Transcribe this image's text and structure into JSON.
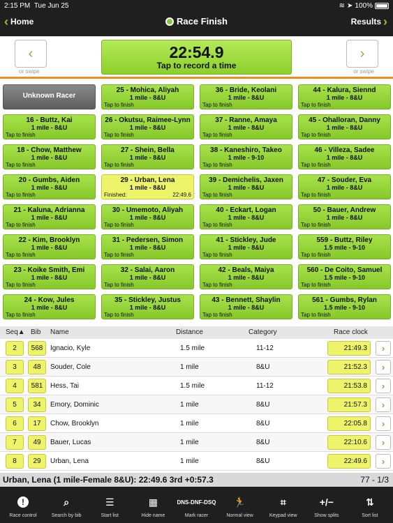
{
  "status_bar": {
    "time": "2:15 PM",
    "date": "Tue Jun 25",
    "battery": "100%"
  },
  "nav": {
    "back_label": "Home",
    "title": "Race Finish",
    "forward_label": "Results"
  },
  "clock": {
    "time": "22:54.9",
    "tap_label": "Tap to record a time",
    "swipe_hint": "or swipe"
  },
  "racers": [
    {
      "name": "Unknown Racer",
      "category": "",
      "note": "",
      "time": "",
      "state": "unknown"
    },
    {
      "name": "25 - Mohica, Aliyah",
      "category": "1 mile - 8&U",
      "note": "Tap to finish",
      "time": "",
      "state": "open"
    },
    {
      "name": "36 - Bride, Keolani",
      "category": "1 mile - 8&U",
      "note": "Tap to finish",
      "time": "",
      "state": "open"
    },
    {
      "name": "44 - Kalura, Siennd",
      "category": "1 mile - 8&U",
      "note": "Tap to finish",
      "time": "",
      "state": "open"
    },
    {
      "name": "16 - Buttz, Kai",
      "category": "1 mile - 8&U",
      "note": "Tap to finish",
      "time": "",
      "state": "open"
    },
    {
      "name": "26 - Okutsu, Raimee-Lynn",
      "category": "1 mile - 8&U",
      "note": "Tap to finish",
      "time": "",
      "state": "open"
    },
    {
      "name": "37 - Ranne, Amaya",
      "category": "1 mile - 8&U",
      "note": "Tap to finish",
      "time": "",
      "state": "open"
    },
    {
      "name": "45 - Ohalloran, Danny",
      "category": "1 mile - 8&U",
      "note": "Tap to finish",
      "time": "",
      "state": "open"
    },
    {
      "name": "18 - Chow, Matthew",
      "category": "1 mile - 8&U",
      "note": "Tap to finish",
      "time": "",
      "state": "open"
    },
    {
      "name": "27 - Shein, Bella",
      "category": "1 mile - 8&U",
      "note": "Tap to finish",
      "time": "",
      "state": "open"
    },
    {
      "name": "38 - Kaneshiro, Takeo",
      "category": "1 mile - 9-10",
      "note": "Tap to finish",
      "time": "",
      "state": "open"
    },
    {
      "name": "46 - Villeza, Sadee",
      "category": "1 mile - 8&U",
      "note": "Tap to finish",
      "time": "",
      "state": "open"
    },
    {
      "name": "20 - Gumbs, Aiden",
      "category": "1 mile - 8&U",
      "note": "Tap to finish",
      "time": "",
      "state": "open"
    },
    {
      "name": "29 - Urban, Lena",
      "category": "1 mile - 8&U",
      "note": "Finished:",
      "time": "22:49.6",
      "state": "finished"
    },
    {
      "name": "39 - Demichelis, Jaxen",
      "category": "1 mile - 8&U",
      "note": "Tap to finish",
      "time": "",
      "state": "open"
    },
    {
      "name": "47 - Souder, Eva",
      "category": "1 mile - 8&U",
      "note": "Tap to finish",
      "time": "",
      "state": "open"
    },
    {
      "name": "21 - Kaluna, Adrianna",
      "category": "1 mile - 8&U",
      "note": "Tap to finish",
      "time": "",
      "state": "open"
    },
    {
      "name": "30 - Umemoto, Aliyah",
      "category": "1 mile - 8&U",
      "note": "Tap to finish",
      "time": "",
      "state": "open"
    },
    {
      "name": "40 - Eckart, Logan",
      "category": "1 mile - 8&U",
      "note": "Tap to finish",
      "time": "",
      "state": "open"
    },
    {
      "name": "50 - Bauer, Andrew",
      "category": "1 mile - 8&U",
      "note": "Tap to finish",
      "time": "",
      "state": "open"
    },
    {
      "name": "22 - Kim, Brooklyn",
      "category": "1 mile - 8&U",
      "note": "Tap to finish",
      "time": "",
      "state": "open"
    },
    {
      "name": "31 - Pedersen, Simon",
      "category": "1 mile - 8&U",
      "note": "Tap to finish",
      "time": "",
      "state": "open"
    },
    {
      "name": "41 - Stickley, Jude",
      "category": "1 mile - 8&U",
      "note": "Tap to finish",
      "time": "",
      "state": "open"
    },
    {
      "name": "559 - Buttz, Riley",
      "category": "1.5 mile - 9-10",
      "note": "Tap to finish",
      "time": "",
      "state": "open"
    },
    {
      "name": "23 - Koike Smith, Emi",
      "category": "1 mile - 8&U",
      "note": "Tap to finish",
      "time": "",
      "state": "open"
    },
    {
      "name": "32 - Salai, Aaron",
      "category": "1 mile - 8&U",
      "note": "Tap to finish",
      "time": "",
      "state": "open"
    },
    {
      "name": "42 - Beals, Maiya",
      "category": "1 mile - 8&U",
      "note": "Tap to finish",
      "time": "",
      "state": "open"
    },
    {
      "name": "560 - De Coito, Samuel",
      "category": "1.5 mile - 9-10",
      "note": "Tap to finish",
      "time": "",
      "state": "open"
    },
    {
      "name": "24 - Kow, Jules",
      "category": "1 mile - 8&U",
      "note": "Tap to finish",
      "time": "",
      "state": "open"
    },
    {
      "name": "35 - Stickley, Justus",
      "category": "1 mile - 8&U",
      "note": "Tap to finish",
      "time": "",
      "state": "open"
    },
    {
      "name": "43 - Bennett, Shaylin",
      "category": "1 mile - 8&U",
      "note": "Tap to finish",
      "time": "",
      "state": "open"
    },
    {
      "name": "561 - Gumbs, Rylan",
      "category": "1.5 mile - 9-10",
      "note": "Tap to finish",
      "time": "",
      "state": "open"
    }
  ],
  "table": {
    "headers": {
      "seq": "Seq▲",
      "bib": "Bib",
      "name": "Name",
      "distance": "Distance",
      "category": "Category",
      "clock": "Race clock"
    },
    "rows": [
      {
        "seq": "2",
        "bib": "568",
        "name": "Ignacio, Kyle",
        "distance": "1.5 mile",
        "category": "11-12",
        "clock": "21:49.3"
      },
      {
        "seq": "3",
        "bib": "48",
        "name": "Souder, Cole",
        "distance": "1 mile",
        "category": "8&U",
        "clock": "21:52.3"
      },
      {
        "seq": "4",
        "bib": "581",
        "name": "Hess, Tai",
        "distance": "1.5 mile",
        "category": "11-12",
        "clock": "21:53.8"
      },
      {
        "seq": "5",
        "bib": "34",
        "name": "Emory, Dominic",
        "distance": "1 mile",
        "category": "8&U",
        "clock": "21:57.3"
      },
      {
        "seq": "6",
        "bib": "17",
        "name": "Chow, Brooklyn",
        "distance": "1 mile",
        "category": "8&U",
        "clock": "22:05.8"
      },
      {
        "seq": "7",
        "bib": "49",
        "name": "Bauer, Lucas",
        "distance": "1 mile",
        "category": "8&U",
        "clock": "22:10.6"
      },
      {
        "seq": "8",
        "bib": "29",
        "name": "Urban, Lena",
        "distance": "1 mile",
        "category": "8&U",
        "clock": "22:49.6"
      }
    ]
  },
  "summary": {
    "text": "Urban, Lena (1 mile-Female 8&U): 22:49.6 3rd +0:57.3",
    "page": "77 - 1/3"
  },
  "toolbar": [
    {
      "label": "Race control",
      "icon": "alert-icon",
      "glyph": "!"
    },
    {
      "label": "Search by bib",
      "icon": "search-icon",
      "glyph": "⌕"
    },
    {
      "label": "Start list",
      "icon": "list-icon",
      "glyph": "☰"
    },
    {
      "label": "Hide name",
      "icon": "grid-icon",
      "glyph": "▦"
    },
    {
      "label": "Mark racer",
      "icon": "dns-dnf-dsq-icon",
      "glyph": "DNS-DNF-DSQ"
    },
    {
      "label": "Normal view",
      "icon": "runners-icon",
      "glyph": "🏃"
    },
    {
      "label": "Keypad view",
      "icon": "keypad-icon",
      "glyph": "⌗"
    },
    {
      "label": "Show splits",
      "icon": "plus-minus-icon",
      "glyph": "+/−"
    },
    {
      "label": "Sort list",
      "icon": "sort-icon",
      "glyph": "⇅"
    }
  ],
  "colors": {
    "accent_green": "#8cc63f",
    "highlight_yellow": "#eef46a",
    "divider_orange": "#f28a1c",
    "bar_dark": "#1f1f1f"
  }
}
